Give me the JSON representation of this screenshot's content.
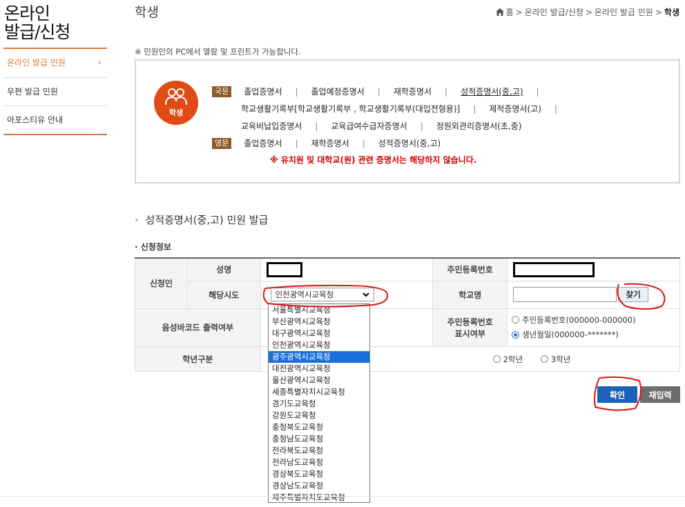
{
  "sidebar": {
    "title_line1": "온라인",
    "title_line2": "발급/신청",
    "items": [
      {
        "label": "온라인 발급 민원",
        "active": true
      },
      {
        "label": "우편 발급 민원"
      },
      {
        "label": "아포스티유 안내"
      }
    ]
  },
  "header": {
    "title": "학생",
    "breadcrumb": [
      "홈",
      "온라인 발급/신청",
      "온라인 발급 민원",
      "학생"
    ]
  },
  "notice": "※ 민원인의 PC에서 열람 및 프린트가 가능합니다.",
  "certificates": {
    "badge_label": "학생",
    "korean_tag": "국문",
    "english_tag": "영문",
    "korean_row1": [
      "졸업증명서",
      "졸업예정증명서",
      "재학증명서",
      "성적증명서(중,고)"
    ],
    "korean_row2": [
      "학교생활기록부[학교생활기록부 , 학교생활기록부(대입전형용)]",
      "제적증명서(고)"
    ],
    "korean_row3": [
      "교육비납입증명서",
      "교육급여수급자증명서",
      "정원외관리증명서(초,중)"
    ],
    "english_row": [
      "졸업증명서",
      "재학증명서",
      "성적증명서(중,고)"
    ],
    "warning": "※ 유치원 및 대학교(원) 관련 증명서는 해당하지 않습니다."
  },
  "section_title": "성적증명서(중,고) 민원 발급",
  "sub_title": "· 신청정보",
  "form": {
    "applicant_label": "신청인",
    "name_label": "성명",
    "resident_no_label": "주민등록번호",
    "region_label": "해당시도",
    "region_selected": "인천광역시교육청",
    "school_label": "학교명",
    "find_button": "찾기",
    "barcode_label": "음성바코드 출력여부",
    "resident_display_label_1": "주민등록번호",
    "resident_display_label_2": "표시여부",
    "resident_option_1": "주민등록번호(000000-000000)",
    "resident_option_2": "생년월일(000000-*******)",
    "grade_label": "학년구분",
    "grade_option_2": "2학년",
    "grade_option_3": "3학년"
  },
  "dropdown_options": [
    "서울특별시교육청",
    "부산광역시교육청",
    "대구광역시교육청",
    "인천광역시교육청",
    "광주광역시교육청",
    "대전광역시교육청",
    "울산광역시교육청",
    "세종특별자치시교육청",
    "경기도교육청",
    "강원도교육청",
    "충청북도교육청",
    "충청남도교육청",
    "전라북도교육청",
    "전라남도교육청",
    "경상북도교육청",
    "경상남도교육청",
    "제주특별자치도교육청"
  ],
  "dropdown_highlighted": "광주광역시교육청",
  "buttons": {
    "confirm": "확인",
    "reset": "재입력"
  },
  "colors": {
    "accent_orange": "#e07a37",
    "badge_red": "#e04a14",
    "tag_brown": "#8b5a2b",
    "confirm_blue": "#1c62b8",
    "highlight_blue": "#1e6fd9",
    "annotation_red": "#e01010"
  }
}
